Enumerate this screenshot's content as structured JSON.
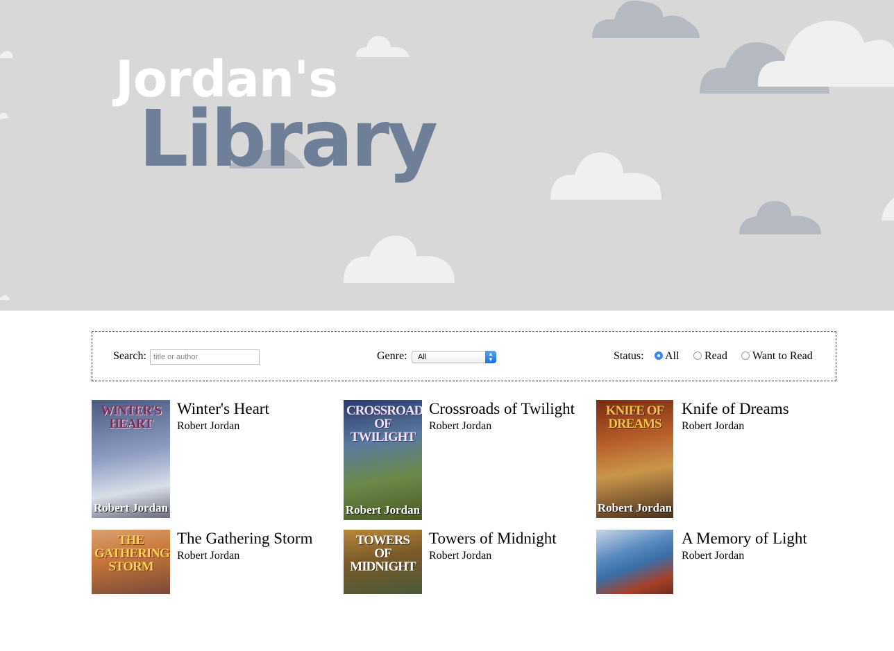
{
  "header": {
    "title_line1": "Jordan's",
    "title_line2": "Library"
  },
  "filters": {
    "search": {
      "label": "Search:",
      "placeholder": "title or author",
      "value": ""
    },
    "genre": {
      "label": "Genre:",
      "selected": "All"
    },
    "status": {
      "label": "Status:",
      "options": [
        {
          "label": "All",
          "checked": true
        },
        {
          "label": "Read",
          "checked": false
        },
        {
          "label": "Want to Read",
          "checked": false
        }
      ]
    }
  },
  "books": [
    {
      "title": "Winter's Heart",
      "author": "Robert Jordan",
      "cover_title": "Winter's Heart",
      "cover_author": "Robert Jordan",
      "cover_colors": [
        "#5a6a8c",
        "#b9c3d6",
        "#8a7a8c"
      ],
      "cover_text_color": "#7a2c5a"
    },
    {
      "title": "Crossroads of Twilight",
      "author": "Robert Jordan",
      "cover_title": "Crossroads of Twilight",
      "cover_author": "Robert Jordan",
      "cover_colors": [
        "#3a4f7a",
        "#6c8a5a",
        "#5c6b2f"
      ],
      "cover_text_color": "#e9e4f0"
    },
    {
      "title": "Knife of Dreams",
      "author": "Robert Jordan",
      "cover_title": "Knife of Dreams",
      "cover_author": "Robert Jordan",
      "cover_colors": [
        "#8a3a1c",
        "#c9853a",
        "#5a3a2a"
      ],
      "cover_text_color": "#f0c24a"
    },
    {
      "title": "The Gathering Storm",
      "author": "Robert Jordan",
      "cover_title": "The Gathering Storm",
      "cover_author": "",
      "cover_colors": [
        "#c9783a",
        "#d9a070",
        "#7a4a3a"
      ],
      "cover_text_color": "#f3d25a"
    },
    {
      "title": "Towers of Midnight",
      "author": "Robert Jordan",
      "cover_title": "Towers of Midnight",
      "cover_author": "",
      "cover_colors": [
        "#7a5a2a",
        "#b8863a",
        "#4a5a3a"
      ],
      "cover_text_color": "#ffffff"
    },
    {
      "title": "A Memory of Light",
      "author": "Robert Jordan",
      "cover_title": "",
      "cover_author": "",
      "cover_colors": [
        "#3a6fa8",
        "#c9d6e6",
        "#a8402a"
      ],
      "cover_text_color": "#ffffff"
    }
  ],
  "colors": {
    "hero_bg": "#d8d8d8",
    "cloud_light": "#f0f0f0",
    "cloud_dark": "#b5bac2",
    "title_white": "#ffffff",
    "title_slate": "#6f7f98",
    "radio_accent": "#3b8af5"
  },
  "icons": {
    "select_arrows": "chevron-up-down-icon",
    "radio_selected": "radio-selected-icon",
    "radio_unselected": "radio-unselected-icon"
  }
}
